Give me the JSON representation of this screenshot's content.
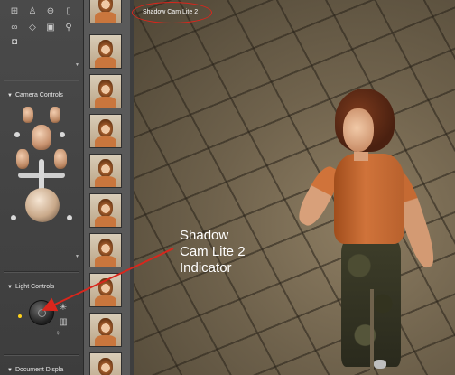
{
  "viewport": {
    "label": "Shadow Cam Lite 2"
  },
  "left_panel": {
    "camera_section": {
      "label": "Camera Controls"
    },
    "light_section": {
      "label": "Light Controls"
    },
    "document_section": {
      "label": "Document Displa"
    },
    "toolbar_icons": [
      "grid-icon",
      "figure-icon",
      "cylinder-icon",
      "tube-icon",
      "chain-icon",
      "cube-icon",
      "box-icon",
      "magnifier-icon",
      "camera-icon"
    ]
  },
  "thumbnails": {
    "count": 11
  },
  "annotation": {
    "line1": "Shadow",
    "line2": "Cam Lite 2",
    "line3": "Indicator"
  },
  "colors": {
    "highlight_ring": "#d9261c",
    "panel_bg": "#444444",
    "viewport_floor": "#7a6c55"
  }
}
